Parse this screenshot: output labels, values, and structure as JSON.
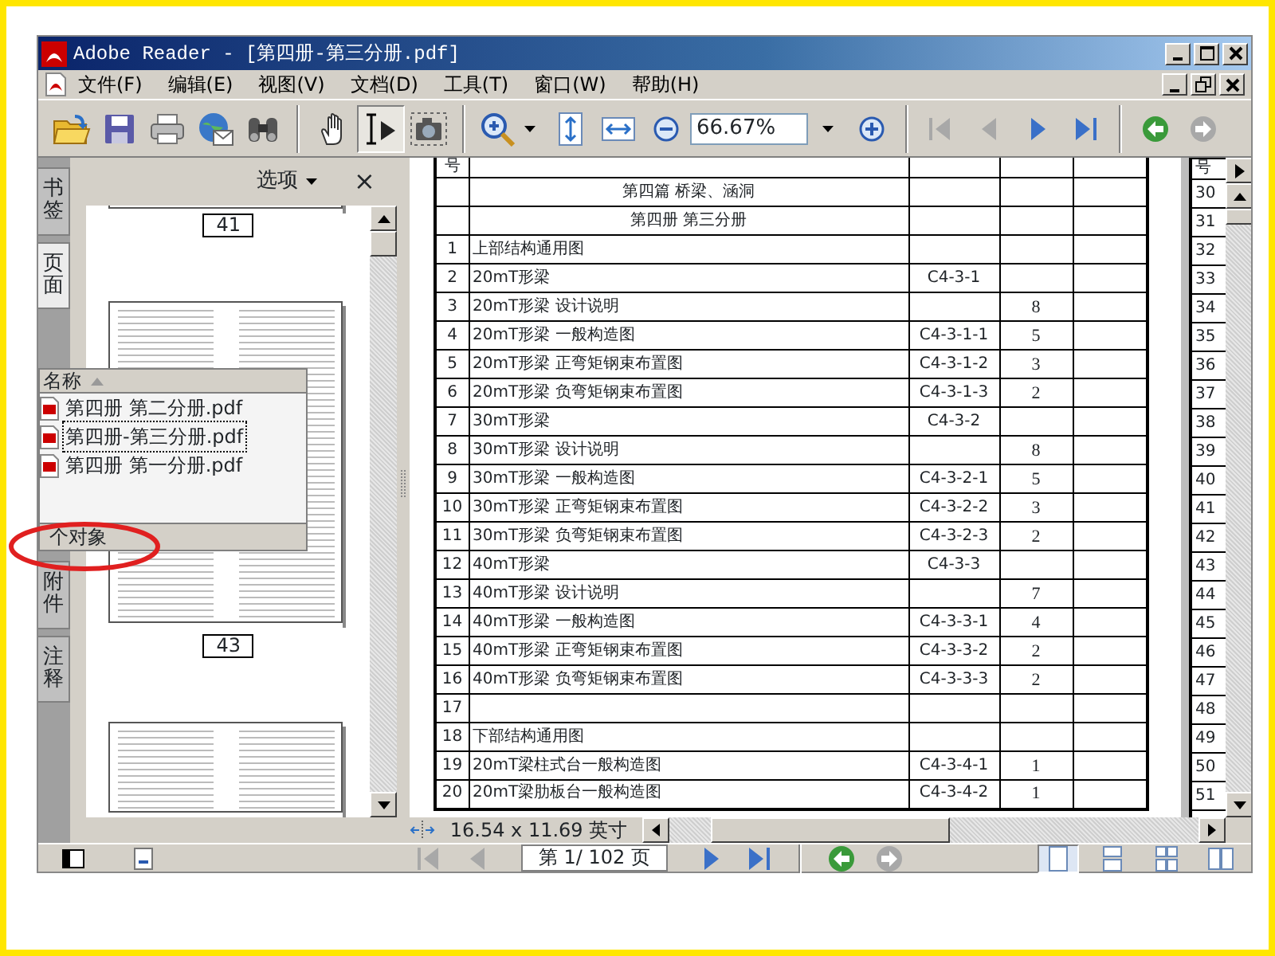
{
  "window": {
    "title": "Adobe Reader - [第四册-第三分册.pdf]"
  },
  "menu": [
    {
      "label": "文件(F)"
    },
    {
      "label": "编辑(E)"
    },
    {
      "label": "视图(V)"
    },
    {
      "label": "文档(D)"
    },
    {
      "label": "工具(T)"
    },
    {
      "label": "窗口(W)"
    },
    {
      "label": "帮助(H)"
    }
  ],
  "toolbar": {
    "tools": [
      {
        "kind": "hand",
        "selected": false
      },
      {
        "kind": "select",
        "selected": true
      },
      {
        "kind": "snapshot",
        "selected": false
      }
    ],
    "zoom": "66.67%",
    "nav": [
      {
        "kind": "first",
        "disabled": true
      },
      {
        "kind": "prev",
        "disabled": true
      },
      {
        "kind": "next",
        "disabled": false
      },
      {
        "kind": "last",
        "disabled": false
      },
      {
        "kind": "back",
        "disabled": false
      },
      {
        "kind": "forward",
        "disabled": true
      }
    ]
  },
  "nav_tabs": [
    {
      "label": "书签",
      "selected": false
    },
    {
      "label": "页面",
      "selected": true
    },
    {
      "label": "附件",
      "selected": false
    },
    {
      "label": "注释",
      "selected": false
    }
  ],
  "pages_panel": {
    "options": "选项",
    "close": "×",
    "thumbnail_labels": [
      "41",
      "43"
    ]
  },
  "attachments": {
    "header": "名称",
    "files": [
      {
        "name": "第四册 第二分册.pdf",
        "selected": false
      },
      {
        "name": "第四册-第三分册.pdf",
        "selected": true
      },
      {
        "name": "第四册 第一分册.pdf",
        "selected": false
      }
    ],
    "footer": "个对象"
  },
  "document": {
    "column_1": "号",
    "rows": [
      {
        "kind": "heading",
        "name": "第四篇 桥梁、涵洞"
      },
      {
        "kind": "heading",
        "name": "第四册 第三分册"
      },
      {
        "kind": "item",
        "no": "1",
        "name": "上部结构通用图"
      },
      {
        "kind": "item",
        "no": "2",
        "name": "20mT形梁",
        "code": "C4-3-1"
      },
      {
        "kind": "item",
        "no": "3",
        "name": "20mT形梁 设计说明",
        "count": "8"
      },
      {
        "kind": "item",
        "no": "4",
        "name": "20mT形梁 一般构造图",
        "code": "C4-3-1-1",
        "count": "5"
      },
      {
        "kind": "item",
        "no": "5",
        "name": "20mT形梁 正弯矩钢束布置图",
        "code": "C4-3-1-2",
        "count": "3"
      },
      {
        "kind": "item",
        "no": "6",
        "name": "20mT形梁 负弯矩钢束布置图",
        "code": "C4-3-1-3",
        "count": "2"
      },
      {
        "kind": "item",
        "no": "7",
        "name": "30mT形梁",
        "code": "C4-3-2"
      },
      {
        "kind": "item",
        "no": "8",
        "name": "30mT形梁 设计说明",
        "count": "8"
      },
      {
        "kind": "item",
        "no": "9",
        "name": "30mT形梁 一般构造图",
        "code": "C4-3-2-1",
        "count": "5"
      },
      {
        "kind": "item",
        "no": "10",
        "name": "30mT形梁 正弯矩钢束布置图",
        "code": "C4-3-2-2",
        "count": "3"
      },
      {
        "kind": "item",
        "no": "11",
        "name": "30mT形梁 负弯矩钢束布置图",
        "code": "C4-3-2-3",
        "count": "2"
      },
      {
        "kind": "item",
        "no": "12",
        "name": "40mT形梁",
        "code": "C4-3-3"
      },
      {
        "kind": "item",
        "no": "13",
        "name": "40mT形梁 设计说明",
        "count": "7"
      },
      {
        "kind": "item",
        "no": "14",
        "name": "40mT形梁 一般构造图",
        "code": "C4-3-3-1",
        "count": "4"
      },
      {
        "kind": "item",
        "no": "15",
        "name": "40mT形梁 正弯矩钢束布置图",
        "code": "C4-3-3-2",
        "count": "2"
      },
      {
        "kind": "item",
        "no": "16",
        "name": "40mT形梁 负弯矩钢束布置图",
        "code": "C4-3-3-3",
        "count": "2"
      },
      {
        "kind": "item",
        "no": "17"
      },
      {
        "kind": "item",
        "no": "18",
        "name": "下部结构通用图"
      },
      {
        "kind": "item",
        "no": "19",
        "name": "20mT梁柱式台一般构造图",
        "code": "C4-3-4-1",
        "count": "1"
      },
      {
        "kind": "item",
        "no": "20",
        "name": "20mT梁肋板台一般构造图",
        "code": "C4-3-4-2",
        "count": "1"
      }
    ]
  },
  "next_page": {
    "column_1": "号",
    "numbers": [
      "30",
      "31",
      "32",
      "33",
      "34",
      "35",
      "36",
      "37",
      "38",
      "39",
      "40",
      "41",
      "42",
      "43",
      "44",
      "45",
      "46",
      "47",
      "48",
      "49",
      "50",
      "51"
    ]
  },
  "status": {
    "page_size": "16.54 x 11.69 英寸",
    "page_field": "第 1/ 102 页",
    "nav": [
      {
        "kind": "first",
        "disabled": true
      },
      {
        "kind": "prev",
        "disabled": true
      },
      {
        "kind": "next",
        "disabled": false
      },
      {
        "kind": "last",
        "disabled": false
      },
      {
        "kind": "back",
        "disabled": false
      },
      {
        "kind": "forward",
        "disabled": true
      }
    ],
    "layouts": [
      {
        "kind": "single",
        "selected": true
      },
      {
        "kind": "continuous",
        "selected": false
      },
      {
        "kind": "continuous-facing",
        "selected": false
      },
      {
        "kind": "facing",
        "selected": false
      }
    ]
  }
}
